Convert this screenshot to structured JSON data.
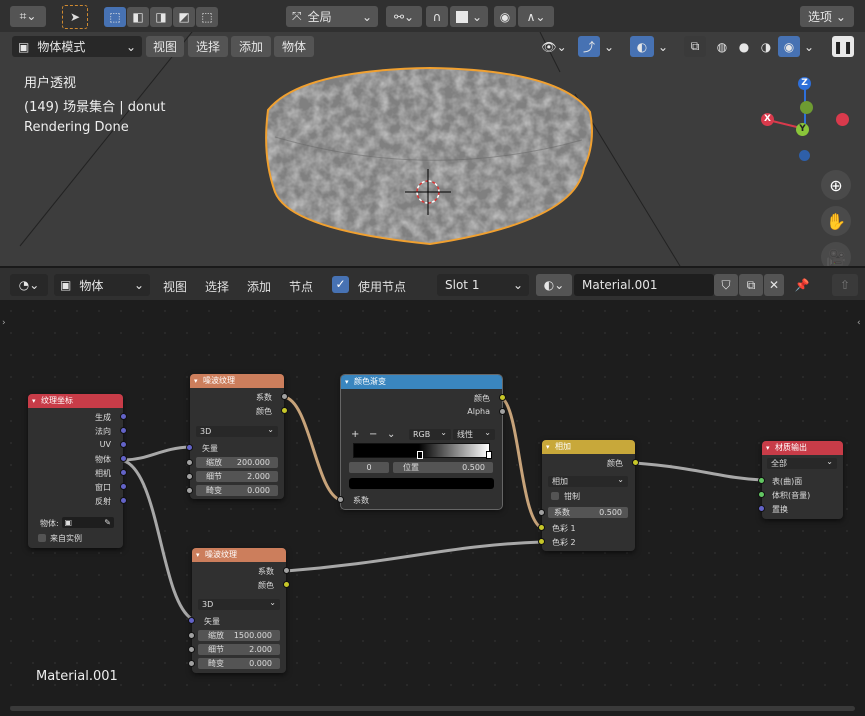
{
  "top_toolbar": {
    "transform_orientation": "全局",
    "options": "选项"
  },
  "viewport_header": {
    "mode": "物体模式",
    "menus": [
      "视图",
      "选择",
      "添加",
      "物体"
    ]
  },
  "viewport": {
    "line1": "用户透视",
    "line2": "(149) 场景集合 | donut",
    "line3": "Rendering Done",
    "gizmo": {
      "z": "Z",
      "x": "X",
      "y": "Y"
    }
  },
  "node_header": {
    "object_mode": "物体",
    "menus": [
      "视图",
      "选择",
      "添加",
      "节点"
    ],
    "use_nodes_label": "使用节点",
    "slot": "Slot 1",
    "material": "Material.001"
  },
  "editor_label": "Material.001",
  "nodes": {
    "texcoord": {
      "title": "纹理坐标",
      "outputs": [
        "生成",
        "法向",
        "UV",
        "物体",
        "相机",
        "窗口",
        "反射"
      ],
      "object_label": "物体:",
      "from_instancer": "来自实例"
    },
    "noise1": {
      "title": "噪波纹理",
      "outputs": [
        "系数",
        "颜色"
      ],
      "dim": "3D",
      "vector": "矢量",
      "scale_label": "缩放",
      "scale": "200.000",
      "detail_label": "细节",
      "detail": "2.000",
      "distortion_label": "畸变",
      "distortion": "0.000"
    },
    "ramp": {
      "title": "颜色渐变",
      "outputs": [
        "颜色",
        "Alpha"
      ],
      "mode": "RGB",
      "interp": "线性",
      "index": "0",
      "pos_label": "位置",
      "pos": "0.500",
      "input": "系数"
    },
    "noise2": {
      "title": "噪波纹理",
      "outputs": [
        "系数",
        "颜色"
      ],
      "dim": "3D",
      "vector": "矢量",
      "scale_label": "缩放",
      "scale": "1500.000",
      "detail_label": "细节",
      "detail": "2.000",
      "distortion_label": "畸变",
      "distortion": "0.000"
    },
    "mix": {
      "title": "相加",
      "output": "颜色",
      "blend": "相加",
      "clamp": "钳制",
      "fac_label": "系数",
      "fac": "0.500",
      "in1": "色彩 1",
      "in2": "色彩 2"
    },
    "output": {
      "title": "材质输出",
      "target": "全部",
      "inputs": [
        "表(曲)面",
        "体积(音量)",
        "置换"
      ]
    }
  },
  "colors": {
    "texcoord_header": "#c83c48",
    "tex_header": "#cc7e5c",
    "converter_header": "#3a86bf",
    "color_header": "#c8a83a",
    "output_header": "#c83c48",
    "accent": "#4772b3"
  }
}
